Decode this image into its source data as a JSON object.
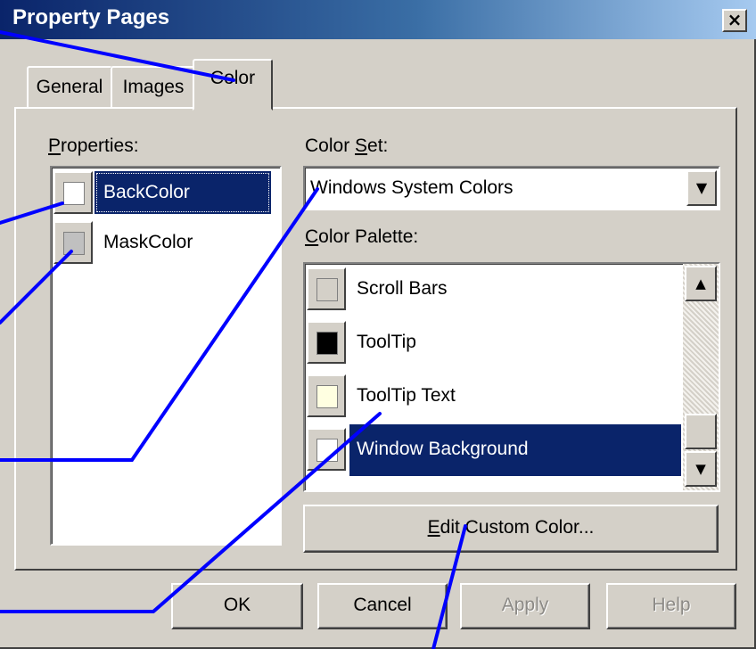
{
  "window": {
    "title": "Property Pages",
    "close_glyph": "×"
  },
  "tabs": [
    {
      "label": "General",
      "active": false
    },
    {
      "label": "Images",
      "active": false
    },
    {
      "label": "Color",
      "active": true
    }
  ],
  "properties": {
    "label_underlined": "P",
    "label_rest": "roperties:",
    "items": [
      {
        "label": "BackColor",
        "swatch": "#ffffff",
        "selected": true
      },
      {
        "label": "MaskColor",
        "swatch": "#c0c0c0",
        "selected": false
      }
    ]
  },
  "color_set": {
    "label_before": "Color ",
    "label_underlined": "S",
    "label_after": "et:",
    "value": "Windows System Colors",
    "arrow_glyph": "▼"
  },
  "color_palette": {
    "label_underlined": "C",
    "label_rest": "olor Palette:",
    "items": [
      {
        "label": "Scroll Bars",
        "swatch": "#d4d0c8",
        "selected": false
      },
      {
        "label": "ToolTip",
        "swatch": "#000000",
        "selected": false
      },
      {
        "label": "ToolTip Text",
        "swatch": "#ffffe1",
        "selected": false
      },
      {
        "label": "Window Background",
        "swatch": "#ffffff",
        "selected": true
      }
    ],
    "scroll_up_glyph": "▲",
    "scroll_down_glyph": "▼"
  },
  "edit_custom_color": {
    "label_underlined": "E",
    "label_rest": "dit Custom Color..."
  },
  "buttons": {
    "ok": "OK",
    "cancel": "Cancel",
    "apply": "Apply",
    "help": "Help"
  },
  "colors": {
    "selection": "#0a246a",
    "annotation_line": "#0000ff"
  }
}
